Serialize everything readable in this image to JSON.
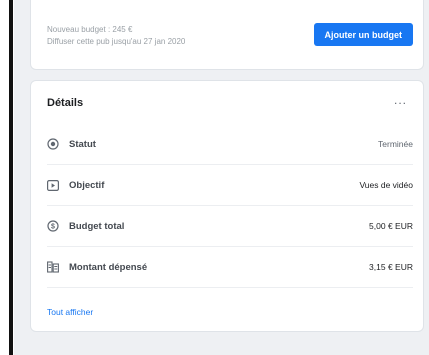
{
  "budget_card": {
    "new_budget_text": "Nouveau budget : 245 €",
    "schedule_text": "Diffuser cette pub jusqu'au 27 jan 2020",
    "add_budget_button": "Ajouter un budget"
  },
  "details": {
    "title": "Détails",
    "more_label": "...",
    "rows": [
      {
        "icon": "status-icon",
        "label": "Statut",
        "value": "Terminée"
      },
      {
        "icon": "objective-icon",
        "label": "Objectif",
        "value": "Vues de vidéo"
      },
      {
        "icon": "budget-icon",
        "label": "Budget total",
        "value": "5,00 € EUR"
      },
      {
        "icon": "spent-icon",
        "label": "Montant dépensé",
        "value": "3,15 € EUR"
      }
    ],
    "show_all_link": "Tout afficher"
  },
  "colors": {
    "accent": "#1877f2",
    "background": "#eef0f3"
  }
}
